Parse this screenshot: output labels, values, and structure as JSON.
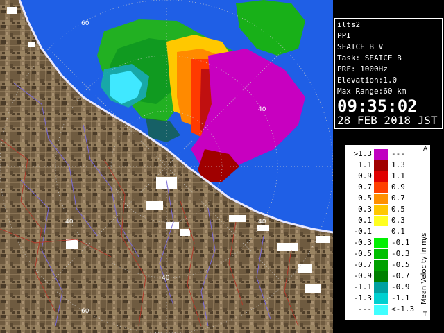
{
  "product_info": {
    "site": "ilts2",
    "scan_type": "PPI",
    "product": "SEAICE_B_V",
    "task": "Task: SEAICE_B",
    "prf": "PRF: 1000Hz",
    "elevation": "Elevation:1.0",
    "max_range": "Max Range:60 km",
    "time": "09:35:02",
    "date": "28 FEB 2018 JST"
  },
  "range_ring_labels": [
    "60",
    "40",
    "40",
    "40",
    "40",
    "60"
  ],
  "colors": {
    "sea": "#1f5fe6",
    "land": "#8a7456",
    "land_dark": "#5b4a33",
    "snow": "#ffffff",
    "coast": "#e8e8ff",
    "river": "#7a6ad8",
    "road": "#b03a2a"
  },
  "legend": {
    "unit_label": "Mean Velocity in m/s",
    "corner_top": "A",
    "corner_bottom": "T",
    "rows": [
      {
        "left": ">1.3",
        "right": "---",
        "color": "#c000c0"
      },
      {
        "left": "1.1",
        "right": "1.3",
        "color": "#a00000"
      },
      {
        "left": "0.9",
        "right": "1.1",
        "color": "#e00000"
      },
      {
        "left": "0.7",
        "right": "0.9",
        "color": "#ff4000"
      },
      {
        "left": "0.5",
        "right": "0.7",
        "color": "#ff9000"
      },
      {
        "left": "0.3",
        "right": "0.5",
        "color": "#ffc800"
      },
      {
        "left": "0.1",
        "right": "0.3",
        "color": "#ffff20"
      },
      {
        "left": "-0.1",
        "right": "0.1",
        "color": "#ffffff"
      },
      {
        "left": "-0.3",
        "right": "-0.1",
        "color": "#00f000"
      },
      {
        "left": "-0.5",
        "right": "-0.3",
        "color": "#00c000"
      },
      {
        "left": "-0.7",
        "right": "-0.5",
        "color": "#00a000"
      },
      {
        "left": "-0.9",
        "right": "-0.7",
        "color": "#008000"
      },
      {
        "left": "-1.1",
        "right": "-0.9",
        "color": "#00a0a0"
      },
      {
        "left": "-1.3",
        "right": "-1.1",
        "color": "#00d0d0"
      },
      {
        "left": "---",
        "right": "<-1.3",
        "color": "#40ffff"
      }
    ]
  }
}
